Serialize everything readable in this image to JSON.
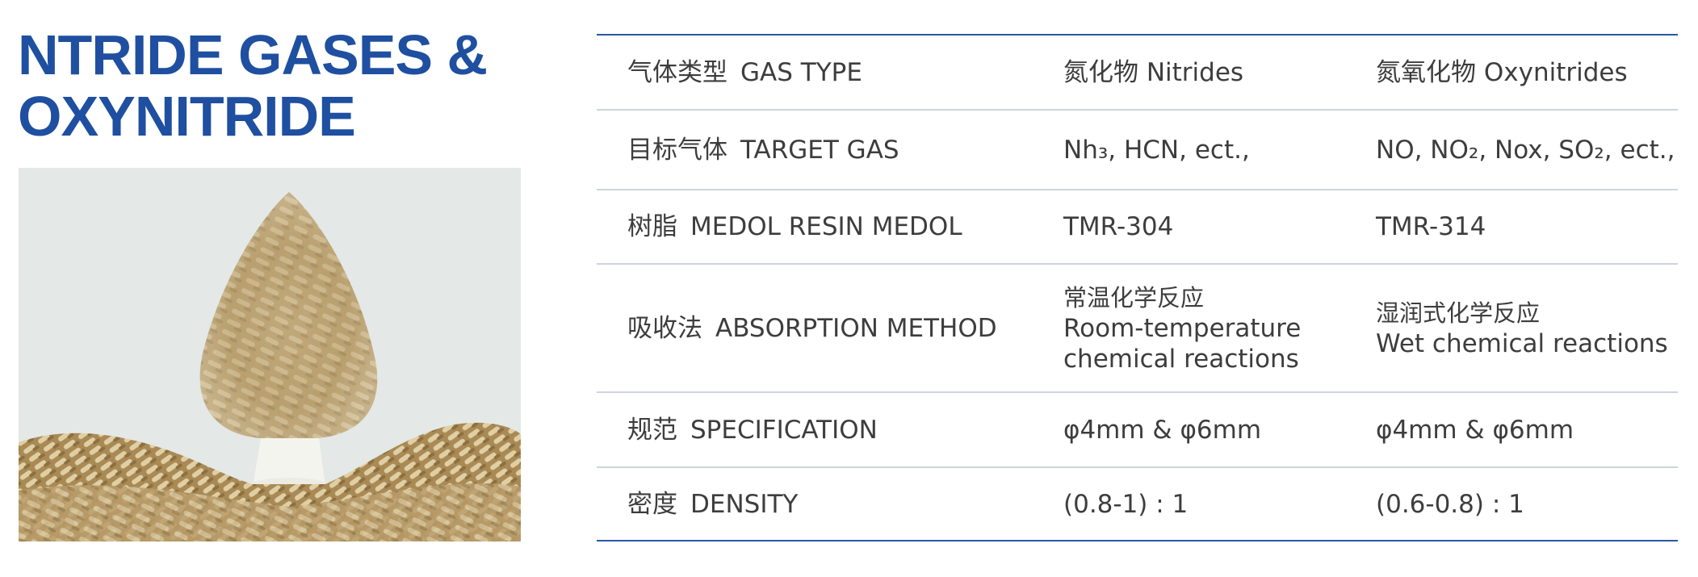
{
  "title": {
    "line1": "NTRIDE GASES &",
    "line2": "OXYNITRIDE"
  },
  "table": {
    "rows": [
      {
        "label_cn": "气体类型",
        "label_en": "GAS TYPE",
        "col2": "氮化物 Nitrides",
        "col3": "氮氧化物 Oxynitrides"
      },
      {
        "label_cn": "目标气体",
        "label_en": "TARGET GAS",
        "col2": "Nh₃, HCN, ect.,",
        "col3": "NO, NO₂, Nox, SO₂, ect.,"
      },
      {
        "label_cn": "树脂",
        "label_en": "MEDOL RESIN MEDOL",
        "col2": "TMR-304",
        "col3": "TMR-314"
      },
      {
        "label_cn": "吸收法",
        "label_en": "ABSORPTION METHOD",
        "col2_cn": "常温化学反应",
        "col2_en1": "Room-temperature",
        "col2_en2": "chemical reactions",
        "col3_cn": "湿润式化学反应",
        "col3_en": "Wet chemical reactions"
      },
      {
        "label_cn": "规范",
        "label_en": "SPECIFICATION",
        "col2": "φ4mm & φ6mm",
        "col3": "φ4mm & φ6mm"
      },
      {
        "label_cn": "密度",
        "label_en": "DENSITY",
        "col2": "(0.8-1) : 1",
        "col3": "(0.6-0.8) : 1"
      }
    ]
  },
  "colors": {
    "brand_blue": "#1f4fa0",
    "rule_blue": "#2a56a6",
    "row_divider": "#cfd4da"
  }
}
